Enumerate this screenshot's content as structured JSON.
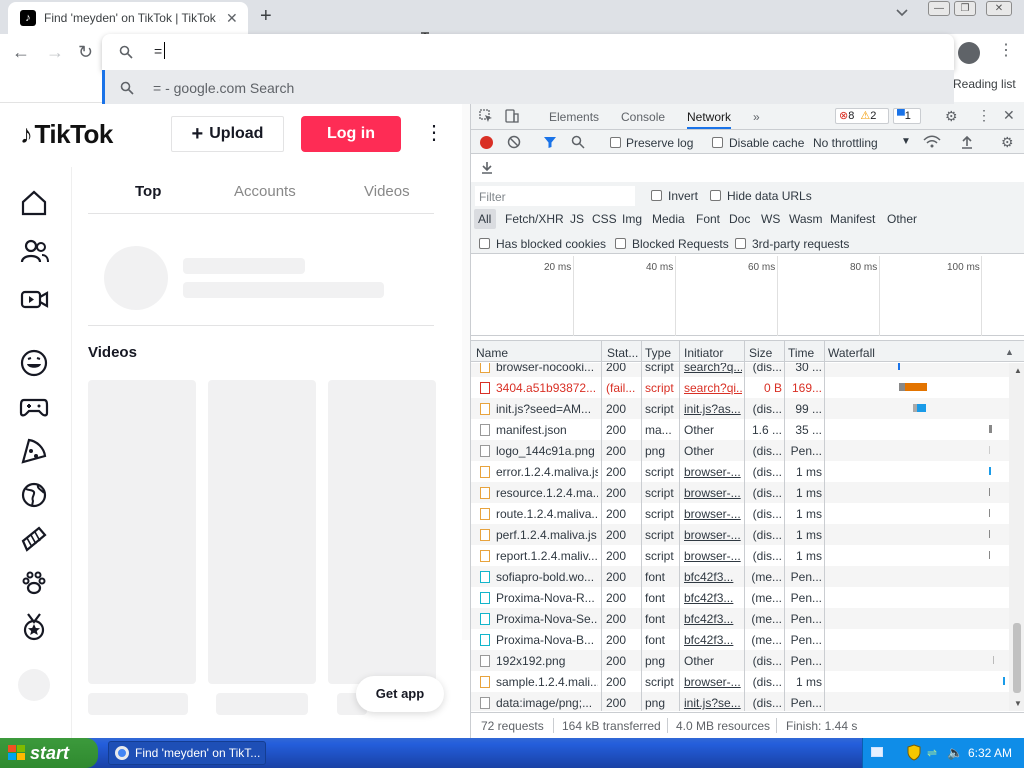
{
  "browser": {
    "tab_title": "Find 'meyden' on TikTok | TikTok Se",
    "tab_favicon": "tiktok-favicon",
    "omnibox_value": "=",
    "suggestion_text": "= - google.com Search",
    "reading_list": "Reading list"
  },
  "tiktok": {
    "logo": "TikTok",
    "upload_label": "Upload",
    "login_label": "Log in",
    "search_tabs": [
      "Top",
      "Accounts",
      "Videos"
    ],
    "active_tab": "Top",
    "videos_heading": "Videos",
    "get_app": "Get app",
    "sidebar_icons": [
      "home-icon",
      "following-icon",
      "live-icon",
      "comedy-icon",
      "gaming-icon",
      "food-icon",
      "travel-icon",
      "beauty-icon",
      "animals-icon",
      "sports-icon"
    ]
  },
  "devtools": {
    "tabs": [
      "Elements",
      "Console",
      "Network"
    ],
    "active_tab": "Network",
    "more_tabs": "»",
    "error_count": "8",
    "warning_count": "2",
    "info_count": "1",
    "preserve_log": "Preserve log",
    "disable_cache": "Disable cache",
    "throttling": "No throttling",
    "filter_placeholder": "Filter",
    "invert": "Invert",
    "hide_data_urls": "Hide data URLs",
    "type_filters": [
      "All",
      "Fetch/XHR",
      "JS",
      "CSS",
      "Img",
      "Media",
      "Font",
      "Doc",
      "WS",
      "Wasm",
      "Manifest",
      "Other"
    ],
    "has_blocked_cookies": "Has blocked cookies",
    "blocked_requests": "Blocked Requests",
    "third_party": "3rd-party requests",
    "timeline_ticks": [
      "20 ms",
      "40 ms",
      "60 ms",
      "80 ms",
      "100 ms"
    ],
    "columns": [
      "Name",
      "Stat...",
      "Type",
      "Initiator",
      "Size",
      "Time",
      "Waterfall"
    ],
    "rows": [
      {
        "name": "browser-nocooki...",
        "status": "200",
        "type": "script",
        "initiator": "search?q...",
        "size": "(dis...",
        "time": "30 ...",
        "error": false,
        "link": true
      },
      {
        "name": "3404.a51b93872...",
        "status": "(fail...",
        "type": "script",
        "initiator": "search?qi...",
        "size": "0 B",
        "time": "169...",
        "error": true,
        "link": true
      },
      {
        "name": "init.js?seed=AM...",
        "status": "200",
        "type": "script",
        "initiator": "init.js?as...",
        "size": "(dis...",
        "time": "99 ...",
        "error": false,
        "link": true
      },
      {
        "name": "manifest.json",
        "status": "200",
        "type": "ma...",
        "initiator": "Other",
        "size": "1.6 ...",
        "time": "35 ...",
        "error": false,
        "link": false
      },
      {
        "name": "logo_144c91a.png",
        "status": "200",
        "type": "png",
        "initiator": "Other",
        "size": "(dis...",
        "time": "Pen...",
        "error": false,
        "link": false
      },
      {
        "name": "error.1.2.4.maliva.js",
        "status": "200",
        "type": "script",
        "initiator": "browser-...",
        "size": "(dis...",
        "time": "1 ms",
        "error": false,
        "link": true
      },
      {
        "name": "resource.1.2.4.ma...",
        "status": "200",
        "type": "script",
        "initiator": "browser-...",
        "size": "(dis...",
        "time": "1 ms",
        "error": false,
        "link": true
      },
      {
        "name": "route.1.2.4.maliva...",
        "status": "200",
        "type": "script",
        "initiator": "browser-...",
        "size": "(dis...",
        "time": "1 ms",
        "error": false,
        "link": true
      },
      {
        "name": "perf.1.2.4.maliva.js",
        "status": "200",
        "type": "script",
        "initiator": "browser-...",
        "size": "(dis...",
        "time": "1 ms",
        "error": false,
        "link": true
      },
      {
        "name": "report.1.2.4.maliv...",
        "status": "200",
        "type": "script",
        "initiator": "browser-...",
        "size": "(dis...",
        "time": "1 ms",
        "error": false,
        "link": true
      },
      {
        "name": "sofiapro-bold.wo...",
        "status": "200",
        "type": "font",
        "initiator": "bfc42f3...",
        "size": "(me...",
        "time": "Pen...",
        "error": false,
        "link": true
      },
      {
        "name": "Proxima-Nova-R...",
        "status": "200",
        "type": "font",
        "initiator": "bfc42f3...",
        "size": "(me...",
        "time": "Pen...",
        "error": false,
        "link": true
      },
      {
        "name": "Proxima-Nova-Se...",
        "status": "200",
        "type": "font",
        "initiator": "bfc42f3...",
        "size": "(me...",
        "time": "Pen...",
        "error": false,
        "link": true
      },
      {
        "name": "Proxima-Nova-B...",
        "status": "200",
        "type": "font",
        "initiator": "bfc42f3...",
        "size": "(me...",
        "time": "Pen...",
        "error": false,
        "link": true
      },
      {
        "name": "192x192.png",
        "status": "200",
        "type": "png",
        "initiator": "Other",
        "size": "(dis...",
        "time": "Pen...",
        "error": false,
        "link": false
      },
      {
        "name": "sample.1.2.4.mali...",
        "status": "200",
        "type": "script",
        "initiator": "browser-...",
        "size": "(dis...",
        "time": "1 ms",
        "error": false,
        "link": true
      },
      {
        "name": "data:image/png;...",
        "status": "200",
        "type": "png",
        "initiator": "init.js?se...",
        "size": "(dis...",
        "time": "Pen...",
        "error": false,
        "link": true
      }
    ],
    "status_requests": "72 requests",
    "status_transferred": "164 kB transferred",
    "status_resources": "4.0 MB resources",
    "status_finish": "Finish: 1.44 s"
  },
  "taskbar": {
    "start_label": "start",
    "task_label": "Find 'meyden' on TikT...",
    "clock": "6:32 AM"
  },
  "colors": {
    "accent": "#fe2c55",
    "chrome_blue": "#1a73e8",
    "xp_blue": "#245edb"
  }
}
